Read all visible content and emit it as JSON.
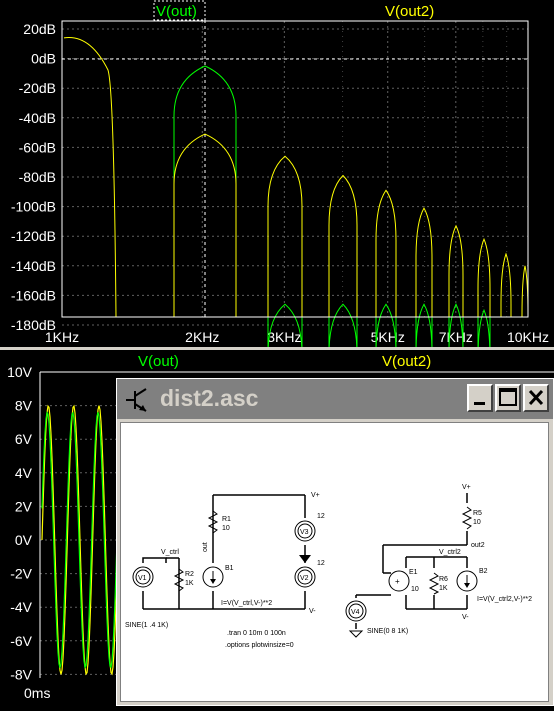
{
  "fft": {
    "trace1": "V(out)",
    "trace2": "V(out2)",
    "y_ticks": [
      "20dB",
      "0dB",
      "-20dB",
      "-40dB",
      "-60dB",
      "-80dB",
      "-100dB",
      "-120dB",
      "-140dB",
      "-160dB",
      "-180dB"
    ],
    "x_ticks": [
      "1KHz",
      "2KHz",
      "3KHz",
      "5KHz",
      "7KHz",
      "10KHz"
    ],
    "colors": {
      "out": "#00ff00",
      "out2": "#ffff00",
      "grid": "#606060",
      "axis": "#ffffff"
    }
  },
  "scope": {
    "trace1": "V(out)",
    "trace2": "V(out2)",
    "y_ticks": [
      "10V",
      "8V",
      "6V",
      "4V",
      "2V",
      "0V",
      "-2V",
      "-4V",
      "-6V",
      "-8V"
    ],
    "x_tick": "0ms"
  },
  "window": {
    "title": "dist2.asc"
  },
  "schematic": {
    "net_vctrl": "V_ctrl",
    "net_out": "out",
    "r1": "R1",
    "r1_val": "10",
    "r2": "R2",
    "r2_val": "1K",
    "v1": "V1",
    "v1_spec": "SINE(1 .4 1K)",
    "b1": "B1",
    "b1_expr": "I=V(V_ctrl,V-)**2",
    "v3": "V3",
    "v3_val": "12",
    "v2": "V2",
    "v2_val": "12",
    "vplus": "V+",
    "vminus": "V-",
    "tran": ".tran 0 10m 0 100n",
    "options": ".options plotwinsize=0",
    "v4": "V4",
    "v4_spec": "SINE(0 8 1K)",
    "e1": "E1",
    "e1_val": "10",
    "r6": "R6",
    "r6_val": "1K",
    "r5": "R5",
    "r5_val": "10",
    "net_vctrl2": "V_ctrl2",
    "net_out2": "out2",
    "b2": "B2",
    "b2_expr": "I=V(V_ctrl2,V-)**2"
  }
}
